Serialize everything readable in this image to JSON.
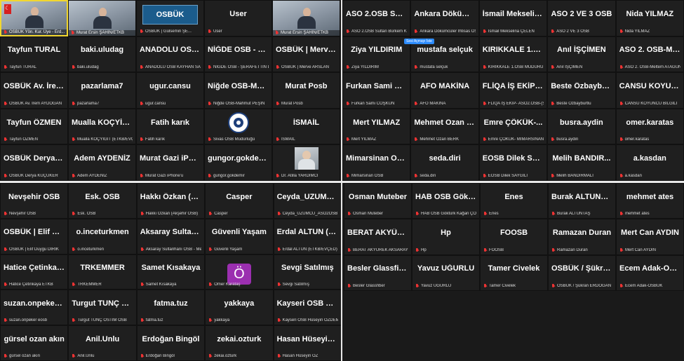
{
  "pane1": {
    "tiles": [
      {
        "type": "video",
        "big": "",
        "label": "OSBÜK Yön. Kur. Üye - Erd...",
        "highlight": true,
        "flag": true
      },
      {
        "type": "video",
        "big": "",
        "label": "Murat Ersin ŞAHİN/ETKB"
      },
      {
        "type": "logo",
        "big": "OSBÜK",
        "label": "OSBÜK | Gülsemin ŞE..."
      },
      {
        "type": "name",
        "big": "User",
        "label": "User"
      },
      {
        "type": "video",
        "big": "",
        "label": "Murat Ersin ŞAHİN/ETKB"
      },
      {
        "type": "name",
        "big": "Tayfun TURAL",
        "label": "Tayfun TURAL"
      },
      {
        "type": "name",
        "big": "baki.uludag",
        "label": "baki.uludag"
      },
      {
        "type": "name",
        "big": "ANADOLU OSB...",
        "label": "ANADOLU OSB KAYHAN SALIK M..."
      },
      {
        "type": "name",
        "big": "NİĞDE OSB - ŞE...",
        "label": "NİĞDE OSB - ŞERAFETTİN DÖNM..."
      },
      {
        "type": "name",
        "big": "OSBÜK | Merve...",
        "label": "OSBÜK | Merve ARSLAN"
      },
      {
        "type": "name",
        "big": "OSBÜK Av. İrem...",
        "label": "OSBÜK Av. İrem AYDOĞAN"
      },
      {
        "type": "name",
        "big": "pazarlama7",
        "label": "pazarlama7"
      },
      {
        "type": "name",
        "big": "ugur.cansu",
        "label": "ugur.cansu"
      },
      {
        "type": "name",
        "big": "Niğde OSB-Mah...",
        "label": "Niğde OSB-Mahmut PEŞİN"
      },
      {
        "type": "name",
        "big": "Murat Posb",
        "label": "Murat Posb"
      },
      {
        "type": "name",
        "big": "Tayfun ÖZMEN",
        "label": "Tayfun ÖZMEN"
      },
      {
        "type": "name",
        "big": "Mualla KOÇYİĞİ...",
        "label": "Mualla KOÇYİĞİT (ETKB/EVÇED)"
      },
      {
        "type": "name",
        "big": "Fatih karık",
        "label": "Fatih karık"
      },
      {
        "type": "round",
        "big": "",
        "label": "Sivas OSB Müdürlüğü"
      },
      {
        "type": "name",
        "big": "İSMAİL",
        "label": "İSMAİL"
      },
      {
        "type": "name",
        "big": "OSBÜK Derya K...",
        "label": "OSBÜK Derya KÜÇÜKER"
      },
      {
        "type": "name",
        "big": "Adem AYDENİZ",
        "label": "Adem AYDENİZ"
      },
      {
        "type": "name",
        "big": "Murat Gazi iPho...",
        "label": "Murat Gazi iPhone'u"
      },
      {
        "type": "name",
        "big": "gungor.gokdemir",
        "label": "gungor.gokdemir"
      },
      {
        "type": "photo",
        "big": "",
        "label": "Dr. Atilla YARDIMCI"
      }
    ]
  },
  "pane2": {
    "tooltip": "Sesi Açmayı İste",
    "tiles": [
      {
        "big": "ASO 2.OSB Sult...",
        "label": "ASO 2.OSB Sultan Bürkem KORK..."
      },
      {
        "big": "Ankara Dökümc...",
        "label": "Ankara Dökümcüler İhtisas OSB /..."
      },
      {
        "big": "İsmail Mekselin...",
        "label": "İsmail Mekselina ÇELEN"
      },
      {
        "big": "ASO 2 VE 3 OSB",
        "label": "ASO 2 VE 3 OSB"
      },
      {
        "big": "Nida YILMAZ",
        "label": "Nida YILMAZ"
      },
      {
        "big": "Ziya YILDIRIM",
        "label": "Ziya YILDIRIM"
      },
      {
        "big": "mustafa selçuk",
        "label": "mustafa selçuk"
      },
      {
        "big": "KIRIKKALE 1.OS...",
        "label": "KIRIKKALE 1.OSB MÜDÜRÜ ALİ Ö..."
      },
      {
        "big": "Anıl İŞÇİMEN",
        "label": "Anıl İŞÇİMEN"
      },
      {
        "big": "ASO 2. OSB-Mel...",
        "label": "ASO 2. OSB-Meltem ATAGÜN"
      },
      {
        "big": "Furkan Sami CO...",
        "label": "Furkan Sami COŞKUN"
      },
      {
        "big": "AFO MAKİNA",
        "label": "AFO MAKİNA"
      },
      {
        "big": "FLİQA İŞ EKİP-...",
        "label": "FLİQA İŞ EKİP- ASO2.OSB-(SİZEM..."
      },
      {
        "big": "Beste Özbaybur...",
        "label": "Beste Özbayburtlu"
      },
      {
        "big": "CANSU KOYUN...",
        "label": "CANSU KOYUNCU BİLGİLİ"
      },
      {
        "big": "Mert YILMAZ",
        "label": "Mert YILMAZ"
      },
      {
        "big": "Mehmet Ozan B...",
        "label": "Mehmet Ozan BERK"
      },
      {
        "big": "Emre ÇÖKÜK-...",
        "label": "Emre ÇÖKÜK- MİMARSİNAN OSB"
      },
      {
        "big": "busra.aydin",
        "label": "busra.aydin"
      },
      {
        "big": "omer.karatas",
        "label": "omer.karatas"
      },
      {
        "big": "Mimarsinan OSB",
        "label": "Mimarsinan OSB"
      },
      {
        "big": "seda.diri",
        "label": "seda.diri"
      },
      {
        "big": "EOSB Dilek SAY...",
        "label": "EOSB Dilek SAYGILI"
      },
      {
        "big": "Melih BANDIR...",
        "label": "Melih BANDIRMALI"
      },
      {
        "big": "a.kasdan",
        "label": "a.kasdan"
      }
    ]
  },
  "pane3": {
    "tiles": [
      {
        "type": "name",
        "big": "Nevşehir OSB",
        "label": "Nevşehir OSB"
      },
      {
        "type": "name",
        "big": "Esk. OSB",
        "label": "Esk. OSB"
      },
      {
        "type": "name",
        "big": "Hakkı Özkan (A...",
        "label": "Hakkı Özkan (Akşehir OSB)"
      },
      {
        "type": "name",
        "big": "Casper",
        "label": "Casper"
      },
      {
        "type": "name",
        "big": "Ceyda_UZUMCU...",
        "label": "Ceyda_UZUMCU_ASO2OSB"
      },
      {
        "type": "name",
        "big": "OSBÜK | Elif Du...",
        "label": "OSBÜK | Elif Duygu DİRİK"
      },
      {
        "type": "name",
        "big": "o.inceturkmen",
        "label": "o.inceturkmen"
      },
      {
        "type": "name",
        "big": "Aksaray Sultanh...",
        "label": "Aksaray Sultanhanı OSB - Mert M..."
      },
      {
        "type": "name",
        "big": "Güvenli Yaşam",
        "label": "Güvenli Yaşam"
      },
      {
        "type": "name",
        "big": "Erdal ALTUN (E...",
        "label": "Erdal ALTUN (ETKB/EVÇED)"
      },
      {
        "type": "name",
        "big": "Hatice Çetinkay...",
        "label": "Hatice Çetinkaya ETKB"
      },
      {
        "type": "name",
        "big": "TRKEMMER",
        "label": "TRKEMMER"
      },
      {
        "type": "name",
        "big": "Samet Kısakaya",
        "label": "Samet Kısakaya"
      },
      {
        "type": "avatar",
        "big": "Ö",
        "label": "Ömer Karataş"
      },
      {
        "type": "name",
        "big": "Sevgi Satılmış",
        "label": "Sevgi Satılmış"
      },
      {
        "type": "name",
        "big": "suzan.onpeker e...",
        "label": "suzan.onpeker eosb"
      },
      {
        "type": "name",
        "big": "Turgut TUNÇ O...",
        "label": "Turgut TUNÇ OSTİM OSB"
      },
      {
        "type": "name",
        "big": "fatma.tuz",
        "label": "fatma.tuz"
      },
      {
        "type": "name",
        "big": "yakkaya",
        "label": "yakkaya"
      },
      {
        "type": "name",
        "big": "Kayseri OSB Hü...",
        "label": "Kayseri OSB Hüseyin ÖZDEMİR"
      },
      {
        "type": "name",
        "big": "gürsel ozan akın",
        "label": "gürsel ozan akın"
      },
      {
        "type": "name",
        "big": "Anil.Unlu",
        "label": "Anil.Unlu"
      },
      {
        "type": "name",
        "big": "Erdoğan Bingöl",
        "label": "Erdoğan Bingöl"
      },
      {
        "type": "name",
        "big": "zekai.ozturk",
        "label": "zekai.ozturk"
      },
      {
        "type": "name",
        "big": "Hasan Hüseyin...",
        "label": "Hasan Hüseyin ÖZ"
      }
    ]
  },
  "pane4": {
    "tiles": [
      {
        "big": "Osman Muteber",
        "label": "Osman Muteber"
      },
      {
        "big": "HAB OSB Göktü...",
        "label": "HAB OSB Göktürk Kağan ÇOBAN"
      },
      {
        "big": "Enes",
        "label": "Enes"
      },
      {
        "big": "Burak ALTUNTAŞ",
        "label": "Burak ALTUNTAŞ"
      },
      {
        "big": "mehmet ates",
        "label": "mehmet ates"
      },
      {
        "big": "BERAT AKYÜRE...",
        "label": "BERAT AKYÜREK AKSARAY OSB"
      },
      {
        "big": "Hp",
        "label": "Hp"
      },
      {
        "big": "FOOSB",
        "label": "FOOSB"
      },
      {
        "big": "Ramazan Duran",
        "label": "Ramazan Duran"
      },
      {
        "big": "Mert Can AYDIN",
        "label": "Mert Can AYDIN"
      },
      {
        "big": "Besler Glassfiber",
        "label": "Besler Glassfiber"
      },
      {
        "big": "Yavuz UĞURLU",
        "label": "Yavuz UĞURLU"
      },
      {
        "big": "Tamer Civelek",
        "label": "Tamer Civelek"
      },
      {
        "big": "OSBÜK / Şükran...",
        "label": "OSBÜK / Şükran ERDOĞAN SEVİM"
      },
      {
        "big": "Ecem Adak-OSB...",
        "label": "Ecem Adak-OSBÜK"
      }
    ]
  }
}
